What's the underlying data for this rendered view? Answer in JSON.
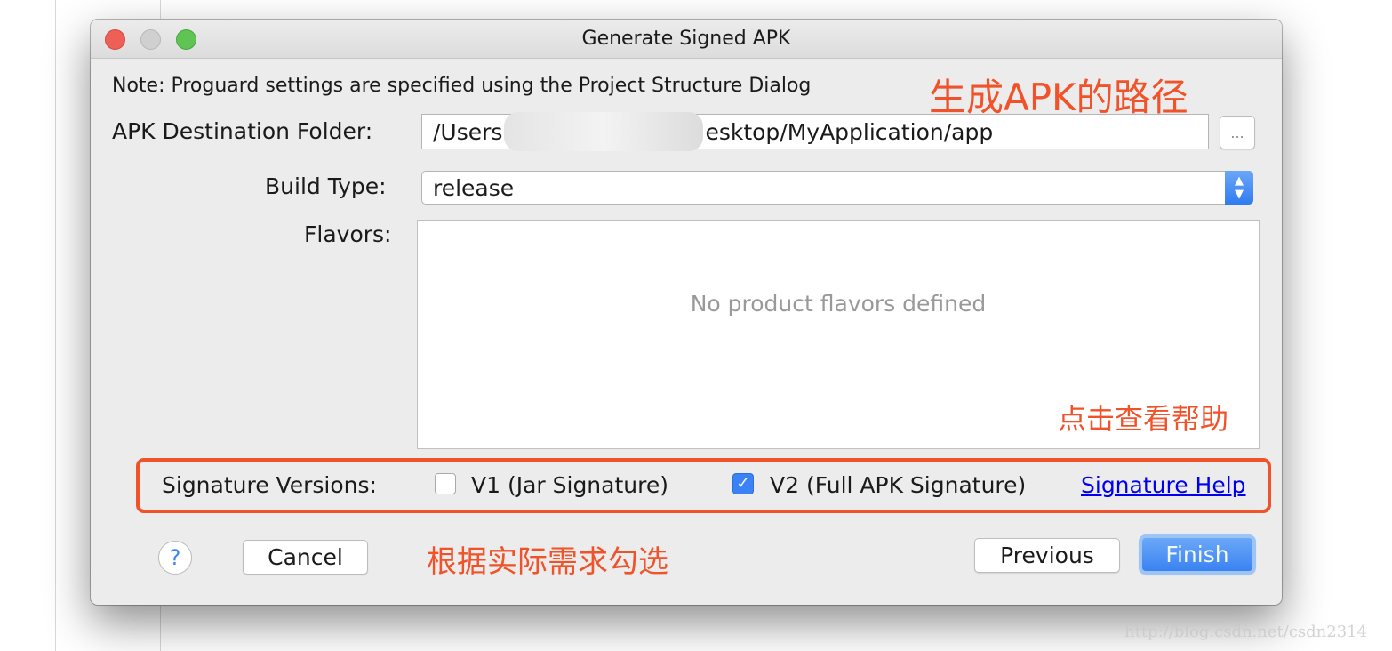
{
  "window": {
    "title": "Generate Signed APK"
  },
  "note": "Note: Proguard settings are specified using the Project Structure Dialog",
  "destination": {
    "label": "APK Destination Folder:",
    "value_prefix": "/Users",
    "value_suffix": "esktop/MyApplication/app",
    "browse_label": "..."
  },
  "build_type": {
    "label": "Build Type:",
    "value": "release"
  },
  "flavors": {
    "label": "Flavors:",
    "empty_text": "No product flavors defined"
  },
  "signature": {
    "label": "Signature Versions:",
    "v1": {
      "label": "V1 (Jar Signature)",
      "checked": false
    },
    "v2": {
      "label": "V2 (Full APK Signature)",
      "checked": true
    },
    "help_link": "Signature Help"
  },
  "buttons": {
    "help": "?",
    "cancel": "Cancel",
    "previous": "Previous",
    "finish": "Finish"
  },
  "annotations": {
    "path": "生成APK的路径",
    "help": "点击查看帮助",
    "select": "根据实际需求勾选"
  },
  "watermark": "http://blog.csdn.net/csdn2314",
  "colors": {
    "annotation": "#f0522a",
    "accent": "#3b82f6",
    "link": "#0000ee"
  }
}
